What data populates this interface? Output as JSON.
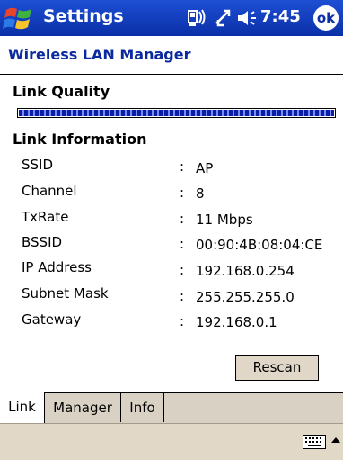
{
  "titlebar": {
    "app_title": "Settings",
    "time": "7:45",
    "ok_label": "ok"
  },
  "page": {
    "header": "Wireless LAN Manager"
  },
  "link_quality": {
    "section_title": "Link Quality",
    "level": 1.0
  },
  "link_information": {
    "section_title": "Link Information",
    "rows": [
      {
        "label": "SSID",
        "value": "AP"
      },
      {
        "label": "Channel",
        "value": "8"
      },
      {
        "label": "TxRate",
        "value": "11 Mbps"
      },
      {
        "label": "BSSID",
        "value": "00:90:4B:08:04:CE"
      },
      {
        "label": "IP Address",
        "value": "192.168.0.254"
      },
      {
        "label": "Subnet Mask",
        "value": "255.255.255.0"
      },
      {
        "label": "Gateway",
        "value": "192.168.0.1"
      }
    ],
    "separator": ":"
  },
  "buttons": {
    "rescan_label": "Rescan"
  },
  "tabs": [
    {
      "label": "Link",
      "active": true
    },
    {
      "label": "Manager",
      "active": false
    },
    {
      "label": "Info",
      "active": false
    }
  ],
  "icons": {
    "start": "windows-flag-icon",
    "connectivity": "connectivity-icon",
    "sync": "sync-arrows-icon",
    "volume": "speaker-icon",
    "keyboard": "keyboard-icon",
    "input_menu": "up-arrow-icon"
  },
  "colors": {
    "titlebar": "#0a2fa8",
    "header_text": "#0b2aa0",
    "quality_fill": "#0a1fa5",
    "button_bg": "#e0d7c8"
  }
}
